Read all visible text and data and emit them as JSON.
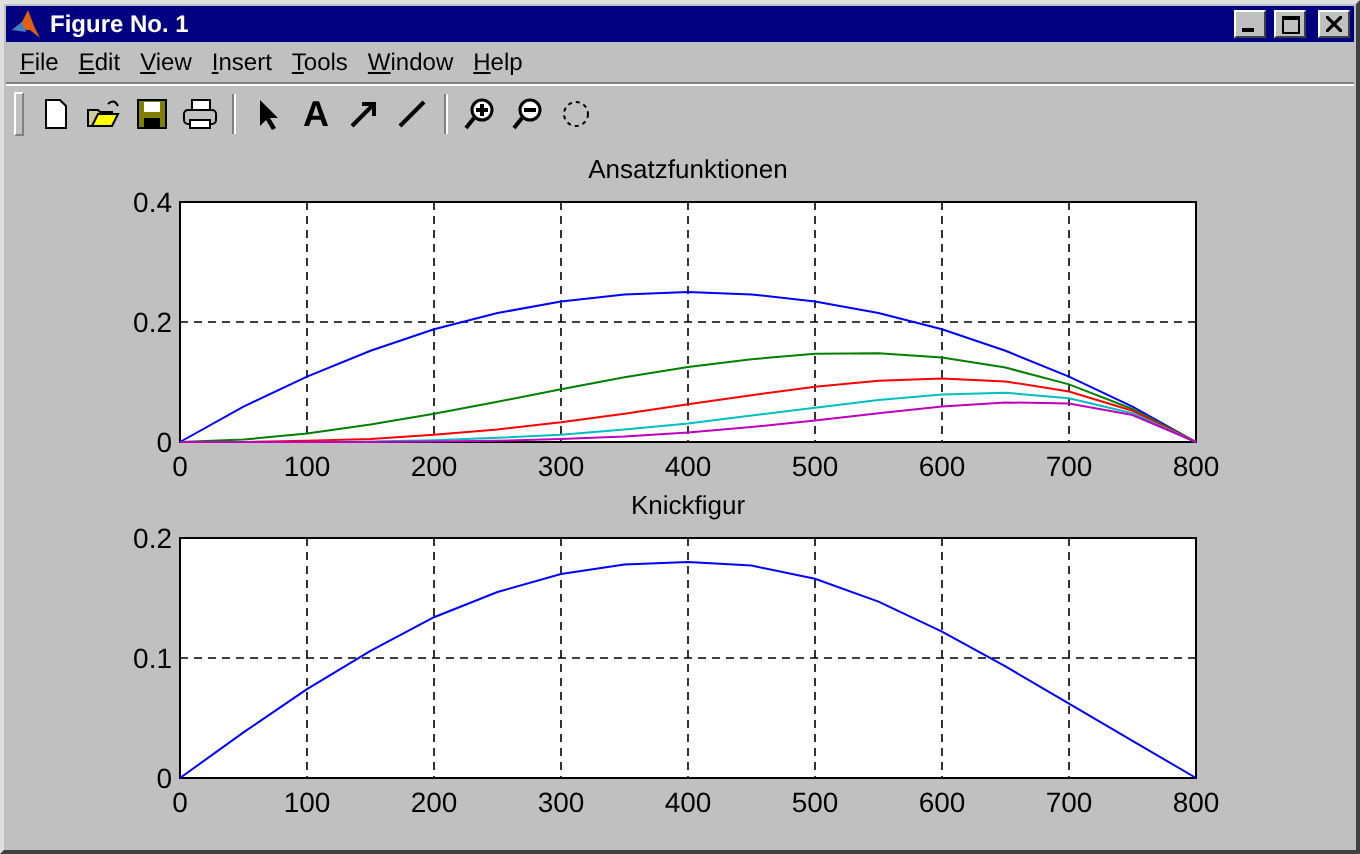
{
  "window": {
    "title": "Figure No. 1"
  },
  "menu": [
    "File",
    "Edit",
    "View",
    "Insert",
    "Tools",
    "Window",
    "Help"
  ],
  "toolbar": [
    [
      {
        "kind": "new"
      },
      {
        "kind": "open"
      },
      {
        "kind": "save"
      },
      {
        "kind": "print"
      }
    ],
    [
      {
        "kind": "pointer"
      },
      {
        "kind": "text",
        "label": "A"
      },
      {
        "kind": "arrow"
      },
      {
        "kind": "line"
      }
    ],
    [
      {
        "kind": "zoom-in"
      },
      {
        "kind": "zoom-out"
      },
      {
        "kind": "rotate"
      }
    ]
  ],
  "charts": [
    {
      "chart_data": {
        "type": "line",
        "title": "Ansatzfunktionen",
        "grid": true,
        "x": [
          0,
          50,
          100,
          150,
          200,
          250,
          300,
          350,
          400,
          450,
          500,
          550,
          600,
          650,
          700,
          750,
          800
        ],
        "xlim": [
          0,
          800
        ],
        "ylim": [
          0,
          0.4
        ],
        "xticks": [
          0,
          100,
          200,
          300,
          400,
          500,
          600,
          700,
          800
        ],
        "yticks": [
          {
            "value": 0,
            "label": "0"
          },
          {
            "value": 0.2,
            "label": "0.2"
          },
          {
            "value": 0.4,
            "label": "0.4"
          }
        ],
        "series": [
          {
            "color": "#0000ff",
            "values": [
              0,
              0.059,
              0.109,
              0.152,
              0.188,
              0.215,
              0.234,
              0.246,
              0.25,
              0.246,
              0.234,
              0.215,
              0.188,
              0.152,
              0.109,
              0.059,
              0
            ]
          },
          {
            "color": "#008000",
            "values": [
              0,
              0.004,
              0.014,
              0.029,
              0.047,
              0.067,
              0.088,
              0.108,
              0.125,
              0.138,
              0.147,
              0.148,
              0.141,
              0.124,
              0.096,
              0.055,
              0
            ]
          },
          {
            "color": "#ff0000",
            "values": [
              0,
              0,
              0.002,
              0.005,
              0.012,
              0.021,
              0.033,
              0.047,
              0.063,
              0.078,
              0.092,
              0.102,
              0.106,
              0.101,
              0.084,
              0.052,
              0
            ]
          },
          {
            "color": "#00bfbf",
            "values": [
              null,
              null,
              0,
              0.001,
              0.003,
              0.007,
              0.012,
              0.021,
              0.031,
              0.044,
              0.057,
              0.07,
              0.079,
              0.082,
              0.073,
              0.048,
              0
            ]
          },
          {
            "color": "#bf00bf",
            "values": [
              0,
              0,
              0,
              0,
              0.001,
              0.002,
              0.005,
              0.009,
              0.016,
              0.025,
              0.036,
              0.048,
              0.059,
              0.066,
              0.064,
              0.045,
              0
            ]
          }
        ]
      }
    },
    {
      "chart_data": {
        "type": "line",
        "title": "Knickfigur",
        "grid": true,
        "x": [
          0,
          50,
          100,
          150,
          200,
          250,
          300,
          350,
          400,
          450,
          500,
          550,
          600,
          650,
          700,
          750,
          800
        ],
        "xlim": [
          0,
          800
        ],
        "ylim": [
          0,
          0.2
        ],
        "xticks": [
          0,
          100,
          200,
          300,
          400,
          500,
          600,
          700,
          800
        ],
        "yticks": [
          {
            "value": 0,
            "label": "0"
          },
          {
            "value": 0.1,
            "label": "0.1"
          },
          {
            "value": 0.2,
            "label": "0.2"
          }
        ],
        "series": [
          {
            "color": "#0000ff",
            "values": [
              0,
              0.038,
              0.074,
              0.106,
              0.134,
              0.155,
              0.17,
              0.178,
              0.18,
              0.177,
              0.166,
              0.147,
              0.122,
              0.093,
              0.062,
              0.031,
              0
            ]
          }
        ]
      }
    }
  ]
}
